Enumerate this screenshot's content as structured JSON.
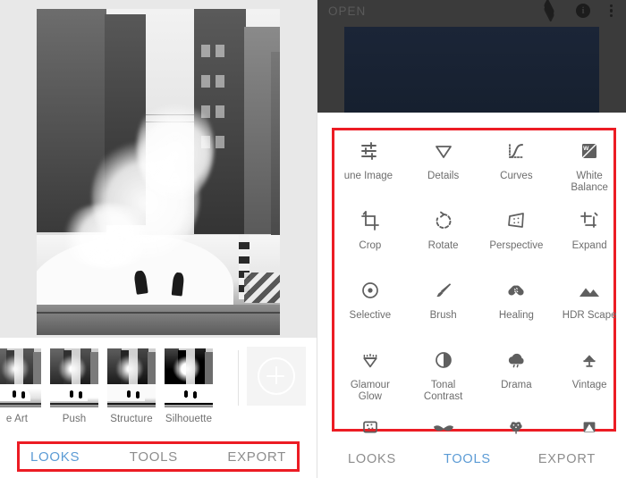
{
  "app": {
    "left_panel": {
      "photo_alt": "black-and-white city street with steam",
      "looks": {
        "items": [
          {
            "label": "e Art",
            "variant": "v-fineart"
          },
          {
            "label": "Push",
            "variant": "v-push"
          },
          {
            "label": "Structure",
            "variant": "v-structure"
          },
          {
            "label": "Silhouette",
            "variant": "v-silhouette"
          }
        ],
        "add_label": "+"
      },
      "bottom_nav": [
        {
          "label": "LOOKS",
          "active": true
        },
        {
          "label": "TOOLS",
          "active": false
        },
        {
          "label": "EXPORT",
          "active": false
        }
      ]
    },
    "right_panel": {
      "top_bar": {
        "open_label": "OPEN",
        "info_glyph": "i",
        "icons": [
          "layers-icon",
          "info-icon",
          "overflow-menu-icon"
        ]
      },
      "tools": [
        {
          "label": "une Image",
          "icon": "tune-image-icon"
        },
        {
          "label": "Details",
          "icon": "details-icon"
        },
        {
          "label": "Curves",
          "icon": "curves-icon"
        },
        {
          "label": "White\nBalance",
          "icon": "white-balance-icon"
        },
        {
          "label": "Crop",
          "icon": "crop-icon"
        },
        {
          "label": "Rotate",
          "icon": "rotate-icon"
        },
        {
          "label": "Perspective",
          "icon": "perspective-icon"
        },
        {
          "label": "Expand",
          "icon": "expand-icon"
        },
        {
          "label": "Selective",
          "icon": "selective-icon"
        },
        {
          "label": "Brush",
          "icon": "brush-icon"
        },
        {
          "label": "Healing",
          "icon": "healing-icon"
        },
        {
          "label": "HDR Scape",
          "icon": "hdr-scape-icon"
        },
        {
          "label": "Glamour\nGlow",
          "icon": "glamour-glow-icon"
        },
        {
          "label": "Tonal\nContrast",
          "icon": "tonal-contrast-icon"
        },
        {
          "label": "Drama",
          "icon": "drama-icon"
        },
        {
          "label": "Vintage",
          "icon": "vintage-icon"
        },
        {
          "label": "",
          "icon": "grainy-film-icon"
        },
        {
          "label": "",
          "icon": "retrolux-icon"
        },
        {
          "label": "",
          "icon": "lens-blur-icon"
        },
        {
          "label": "",
          "icon": "double-exposure-icon"
        }
      ],
      "bottom_nav": [
        {
          "label": "LOOKS",
          "active": false
        },
        {
          "label": "TOOLS",
          "active": true
        },
        {
          "label": "EXPORT",
          "active": false
        }
      ]
    },
    "colors": {
      "accent_blue": "#5b9bd5",
      "highlight_red": "#ec1c24",
      "icon_gray": "#5f5f5f",
      "label_gray": "#6d6d6d",
      "dim_overlay": "#3b3b3b"
    }
  }
}
